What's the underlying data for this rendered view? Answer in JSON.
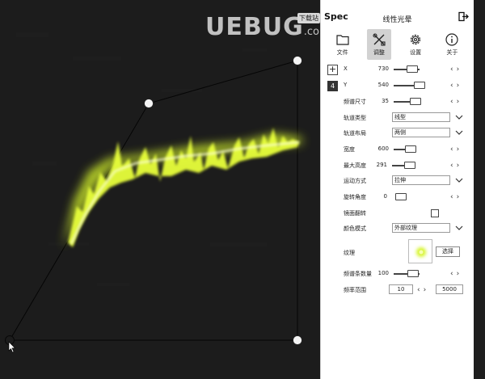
{
  "app": {
    "logo": "Spec",
    "title": "线性光晕"
  },
  "watermark": {
    "text": "UEBUG",
    "suffix": ".com",
    "badge": "下载站"
  },
  "toolbar": [
    {
      "label": "文件",
      "icon": "folder-icon",
      "active": false
    },
    {
      "label": "调整",
      "icon": "tools-icon",
      "active": true
    },
    {
      "label": "设置",
      "icon": "gear-icon",
      "active": false
    },
    {
      "label": "关于",
      "icon": "info-icon",
      "active": false
    }
  ],
  "params": {
    "x": {
      "label": "X",
      "value": "730"
    },
    "y": {
      "label": "Y",
      "value": "540"
    },
    "count_badge": "4",
    "add_label": "+",
    "spectrum_size": {
      "label": "频谱尺寸",
      "value": "35"
    },
    "track_type": {
      "label": "轨道类型",
      "value": "线型"
    },
    "track_layout": {
      "label": "轨道布局",
      "value": "两侧"
    },
    "width": {
      "label": "宽度",
      "value": "600"
    },
    "max_height": {
      "label": "最大高度",
      "value": "291"
    },
    "motion": {
      "label": "运动方式",
      "value": "拉伸"
    },
    "rotation": {
      "label": "旋转角度",
      "value": "0"
    },
    "mirror": {
      "label": "镜面翻转",
      "checked": false
    },
    "color_mode": {
      "label": "颜色模式",
      "value": "外部纹理"
    },
    "texture": {
      "label": "纹理",
      "button": "选择"
    },
    "bar_count": {
      "label": "频谱条数量",
      "value": "100"
    },
    "freq_range": {
      "label": "频率范围",
      "min": "10",
      "max": "5000"
    }
  },
  "colors": {
    "glow": "#e8ff3a",
    "glow_core": "#fbffd0",
    "canvas_bg": "#1c1c1c",
    "panel_bg": "#ffffff"
  }
}
